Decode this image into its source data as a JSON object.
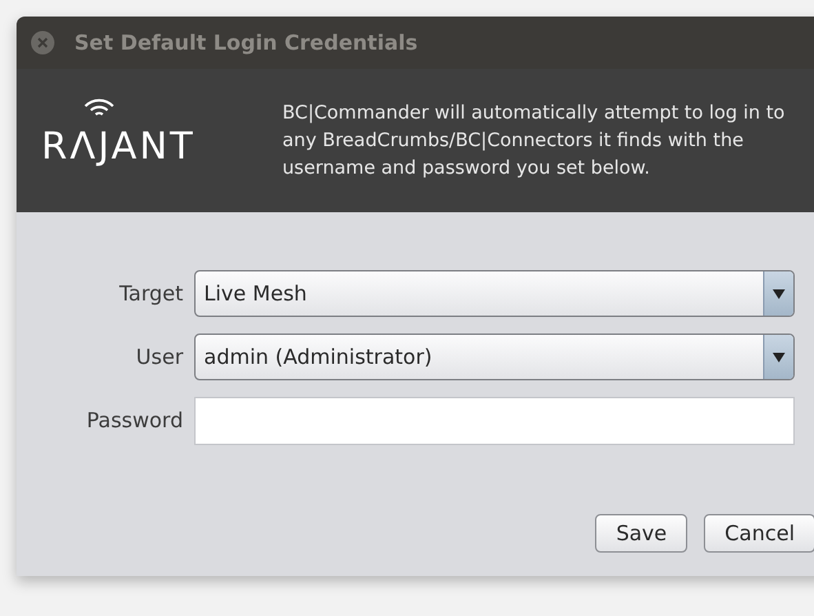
{
  "window": {
    "title": "Set Default Login Credentials"
  },
  "header": {
    "logo": "RΛJANT",
    "message": "BC|Commander will automatically attempt to log in to any BreadCrumbs/BC|Connectors it finds with the username and password you set below."
  },
  "fields": [
    {
      "kind": "dropdown",
      "label": "Target",
      "value": "Live Mesh"
    },
    {
      "kind": "dropdown",
      "label": "User",
      "value": "admin (Administrator)"
    },
    {
      "kind": "text",
      "label": "Password"
    }
  ],
  "buttons": [
    "Save",
    "Cancel"
  ]
}
